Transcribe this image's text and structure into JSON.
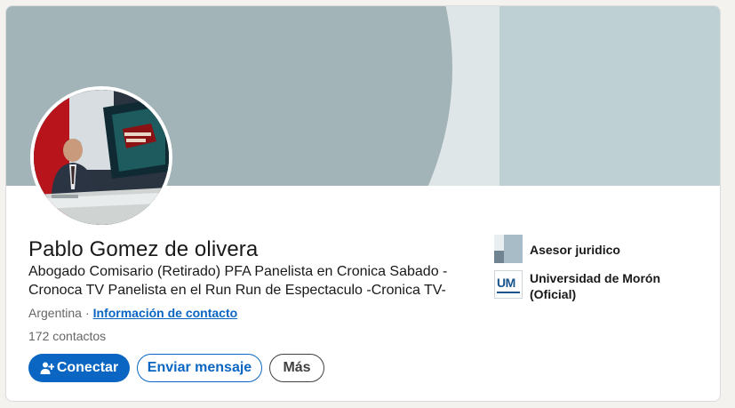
{
  "profile": {
    "name": "Pablo Gomez de olivera",
    "headline_line1": "Abogado Comisario (Retirado) PFA Panelista en Cronica Sabado -",
    "headline_line2": "Cronoca TV Panelista en el Run Run de Espectaculo -Cronica TV-",
    "location": "Argentina",
    "separator": "·",
    "contact_link": "Información de contacto",
    "connections": "172 contactos"
  },
  "actions": {
    "connect": "Conectar",
    "message": "Enviar mensaje",
    "more": "Más"
  },
  "experience": {
    "current_position": "Asesor juridico"
  },
  "education": {
    "school_line1": "Universidad de Morón",
    "school_line2": "(Oficial)",
    "logo_text": "UM"
  },
  "icons": {
    "connect": "add-person-icon",
    "job_logo": "company-logo",
    "edu_logo": "university-logo"
  },
  "colors": {
    "accent": "#0a66c2",
    "banner_circle": "#a2b4b8",
    "banner_right": "#bfd0d5"
  }
}
